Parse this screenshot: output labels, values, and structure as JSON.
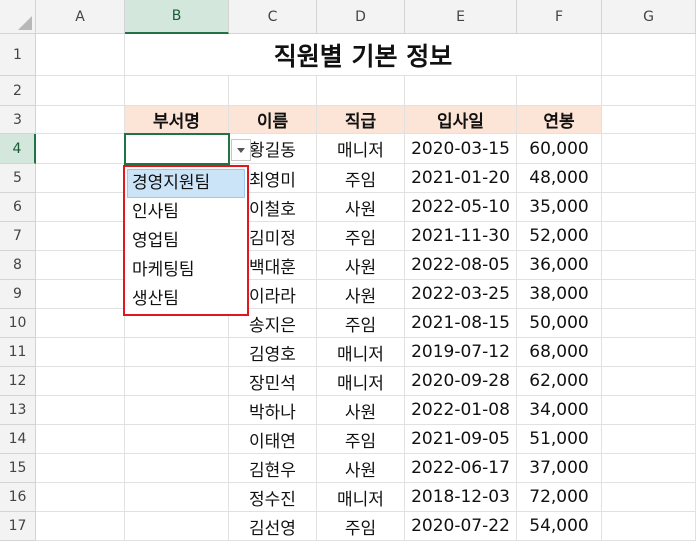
{
  "columns": [
    "A",
    "B",
    "C",
    "D",
    "E",
    "F",
    "G"
  ],
  "selected_column": "B",
  "selected_row": "4",
  "title": "직원별 기본 정보",
  "headers": [
    "부서명",
    "이름",
    "직급",
    "입사일",
    "연봉"
  ],
  "rows": [
    {
      "row": "1"
    },
    {
      "row": "2"
    },
    {
      "row": "3"
    },
    {
      "row": "4",
      "name": "황길동",
      "rank": "매니저",
      "date": "2020-03-15",
      "salary": "60,000"
    },
    {
      "row": "5",
      "name": "최영미",
      "rank": "주임",
      "date": "2021-01-20",
      "salary": "48,000"
    },
    {
      "row": "6",
      "name": "이철호",
      "rank": "사원",
      "date": "2022-05-10",
      "salary": "35,000"
    },
    {
      "row": "7",
      "name": "김미정",
      "rank": "주임",
      "date": "2021-11-30",
      "salary": "52,000"
    },
    {
      "row": "8",
      "name": "백대훈",
      "rank": "사원",
      "date": "2022-08-05",
      "salary": "36,000"
    },
    {
      "row": "9",
      "name": "이라라",
      "rank": "사원",
      "date": "2022-03-25",
      "salary": "38,000"
    },
    {
      "row": "10",
      "name": "송지은",
      "rank": "주임",
      "date": "2021-08-15",
      "salary": "50,000"
    },
    {
      "row": "11",
      "name": "김영호",
      "rank": "매니저",
      "date": "2019-07-12",
      "salary": "68,000"
    },
    {
      "row": "12",
      "name": "장민석",
      "rank": "매니저",
      "date": "2020-09-28",
      "salary": "62,000"
    },
    {
      "row": "13",
      "name": "박하나",
      "rank": "사원",
      "date": "2022-01-08",
      "salary": "34,000"
    },
    {
      "row": "14",
      "name": "이태연",
      "rank": "주임",
      "date": "2021-09-05",
      "salary": "51,000"
    },
    {
      "row": "15",
      "name": "김현우",
      "rank": "사원",
      "date": "2022-06-17",
      "salary": "37,000"
    },
    {
      "row": "16",
      "name": "정수진",
      "rank": "매니저",
      "date": "2018-12-03",
      "salary": "72,000"
    },
    {
      "row": "17",
      "name": "김선영",
      "rank": "주임",
      "date": "2020-07-22",
      "salary": "54,000"
    }
  ],
  "dropdown": {
    "options": [
      "경영지원팀",
      "인사팀",
      "영업팀",
      "마케팅팀",
      "생산팀"
    ],
    "highlighted": "경영지원팀"
  },
  "icons": {
    "dropdown_arrow": "chevron-down-icon",
    "select_all": "select-all-triangle-icon"
  },
  "colors": {
    "header_fill": "#fce4d6",
    "selection_accent": "#217346",
    "dropdown_border": "#e3151d",
    "highlight_fill": "#cce4f7"
  }
}
